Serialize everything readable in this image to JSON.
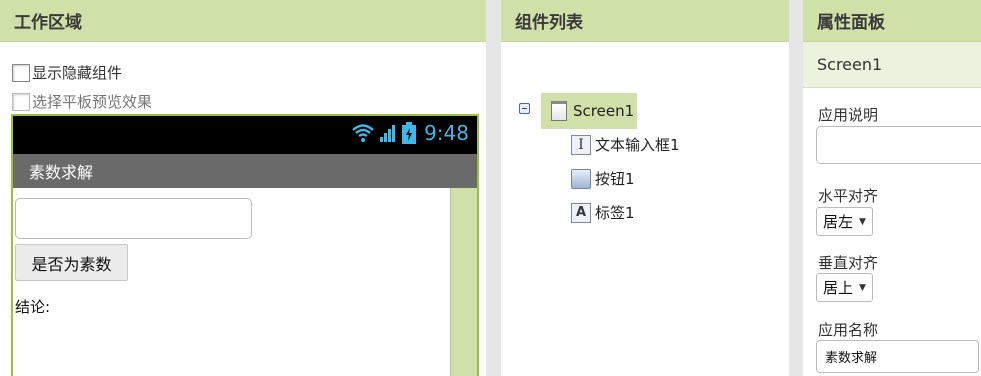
{
  "workspace": {
    "header": "工作区域",
    "show_hidden_label": "显示隐藏组件",
    "tablet_preview_label": "选择平板预览效果",
    "phone": {
      "time": "9:48",
      "title": "素数求解",
      "button_label": "是否为素数",
      "result_label": "结论:"
    }
  },
  "components": {
    "header": "组件列表",
    "root": "Screen1",
    "items": [
      {
        "label": "文本输入框1",
        "icon": "textbox-icon"
      },
      {
        "label": "按钮1",
        "icon": "button-icon"
      },
      {
        "label": "标签1",
        "icon": "label-icon"
      }
    ]
  },
  "properties": {
    "header": "属性面板",
    "component": "Screen1",
    "app_description_label": "应用说明",
    "h_align_label": "水平对齐",
    "h_align_value": "居左",
    "v_align_label": "垂直对齐",
    "v_align_value": "居上",
    "app_name_label": "应用名称",
    "app_name_value": "素数求解"
  },
  "colors": {
    "header_bg": "#cfe0a8",
    "phone_border": "#9bc13a",
    "clock": "#3fb7e8"
  }
}
